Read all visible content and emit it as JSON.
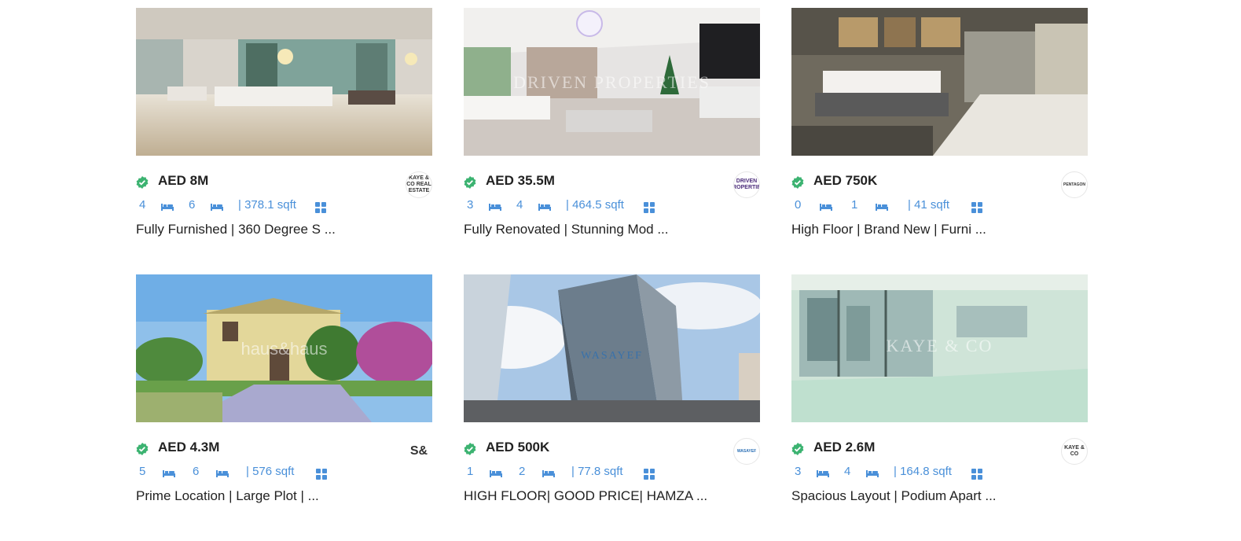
{
  "listings": [
    {
      "price": "AED 8M",
      "bedrooms": "4",
      "bathrooms": "6",
      "area": "| 378.1 sqft",
      "title": "Fully Furnished | 360 Degree S ...",
      "agency_logo": "KAYE & CO REAL ESTATE",
      "photo": "living-room",
      "watermark": ""
    },
    {
      "price": "AED 35.5M",
      "bedrooms": "3",
      "bathrooms": "4",
      "area": "| 464.5 sqft",
      "title": "Fully Renovated | Stunning Mod ...",
      "agency_logo": "DRIVEN PROPERTIES",
      "photo": "living-room-xmas",
      "watermark": "DRIVEN PROPERTIES"
    },
    {
      "price": "AED 750K",
      "bedrooms": "0",
      "bathrooms": "1",
      "area": "| 41 sqft",
      "title": "High Floor | Brand New | Furni ...",
      "agency_logo": "PENTAGON",
      "photo": "bedroom",
      "watermark": ""
    },
    {
      "price": "AED 4.3M",
      "bedrooms": "5",
      "bathrooms": "6",
      "area": "| 576 sqft",
      "title": "Prime Location | Large Plot | ...",
      "agency_logo": "S&",
      "photo": "villa",
      "watermark": "haus&haus"
    },
    {
      "price": "AED 500K",
      "bedrooms": "1",
      "bathrooms": "2",
      "area": "| 77.8 sqft",
      "title": "HIGH FLOOR| GOOD PRICE| HAMZA ...",
      "agency_logo": "WASAYEF",
      "photo": "tower",
      "watermark": "WASAYEF"
    },
    {
      "price": "AED 2.6M",
      "bedrooms": "3",
      "bathrooms": "4",
      "area": "| 164.8 sqft",
      "title": "Spacious Layout | Podium Apart ...",
      "agency_logo": "KAYE & CO",
      "photo": "empty-room",
      "watermark": "KAYE & CO"
    }
  ],
  "colors": {
    "accent": "#4a90d9",
    "verified": "#3cb371",
    "text": "#222222"
  },
  "icons": {
    "verified": "verified-check-icon",
    "bed": "bed-icon",
    "bath": "bath-icon",
    "gallery": "gallery-grid-icon"
  }
}
